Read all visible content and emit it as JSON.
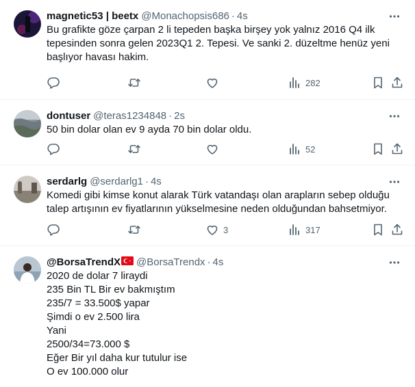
{
  "tweets": [
    {
      "name": "magnetic53 | beetx",
      "handle": "@Monachopsis686",
      "sep": "·",
      "time": "4s",
      "text": "Bu grafikte göze çarpan 2 li tepeden başka birşey yok yalnız 2016 Q4 ilk tepesinden sonra gelen 2023Q1 2. Tepesi. Ve sanki 2. düzeltme henüz yeni başlıyor havası hakim.",
      "replies": "",
      "retweets": "",
      "likes": "",
      "views": "282"
    },
    {
      "name": "dontuser",
      "handle": "@teras1234848",
      "sep": "·",
      "time": "2s",
      "text": "50 bin dolar olan ev 9 ayda 70 bin dolar oldu.",
      "replies": "",
      "retweets": "",
      "likes": "",
      "views": "52"
    },
    {
      "name": "serdarlg",
      "handle": "@serdarlg1",
      "sep": "·",
      "time": "4s",
      "text": "Komedi gibi kimse konut alarak Türk vatandaşı olan arapların sebep olduğu talep artışının ev fiyatlarının yükselmesine neden olduğundan bahsetmiyor.",
      "replies": "",
      "retweets": "",
      "likes": "3",
      "views": "317"
    },
    {
      "name": "@BorsaTrendX",
      "handle": "@BorsaTrendx",
      "sep": "·",
      "time": "4s",
      "text": "2020 de dolar 7 liraydi\n235 Bin TL Bir ev bakmıştım\n235/7 = 33.500$ yapar\nŞimdi o ev 2.500 lira\nYani\n2500/34=73.000 $\nEğer Bir yıl daha kur tutulur ise\nO ev 100.000 olur"
    }
  ]
}
